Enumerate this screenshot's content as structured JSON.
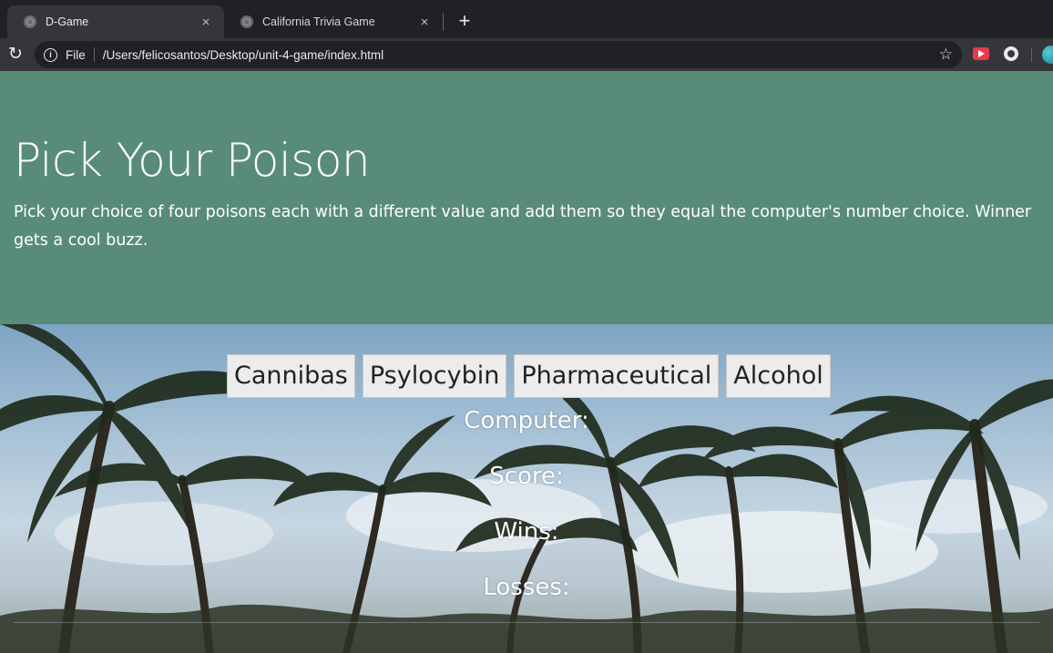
{
  "browser": {
    "tabs": [
      {
        "title": "D-Game",
        "active": true
      },
      {
        "title": "California Trivia Game",
        "active": false
      }
    ],
    "new_tab_label": "+",
    "close_glyph": "×",
    "address": {
      "scheme_label": "File",
      "url": "/Users/felicosantos/Desktop/unit-4-game/index.html"
    },
    "icons": [
      "reload-icon",
      "info-icon",
      "star-icon",
      "extension-icon",
      "extension-icon-2",
      "profile-avatar"
    ]
  },
  "header": {
    "title": "Pick Your Poison",
    "description": "Pick your choice of four poisons each with a different value and add them so they equal the computer's number choice. Winner gets a cool buzz."
  },
  "game": {
    "buttons": [
      "Cannibas",
      "Psylocybin",
      "Pharmaceutical",
      "Alcohol"
    ],
    "labels": {
      "computer": "Computer:",
      "score": "Score:",
      "wins": "Wins:",
      "losses": "Losses:"
    }
  },
  "colors": {
    "jumbotron_bg": "#588c79",
    "browser_frame": "#202124",
    "toolbar": "#35363a",
    "button_bg": "#ececec"
  }
}
